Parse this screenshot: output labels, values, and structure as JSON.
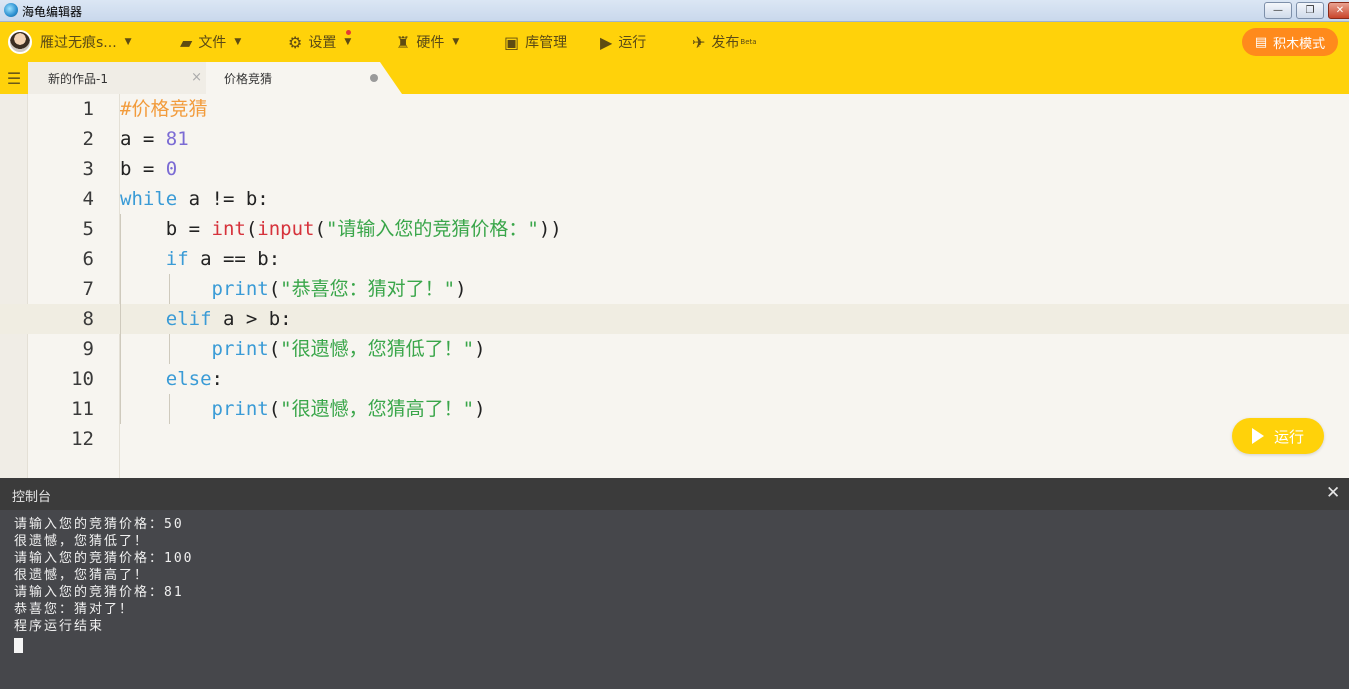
{
  "window": {
    "title": "海龟编辑器",
    "min_glyph": "—",
    "max_glyph": "❐",
    "close_glyph": "✕"
  },
  "toolbar": {
    "user_name": "雁过无痕s...",
    "file": "文件",
    "settings": "设置",
    "hardware": "硬件",
    "library": "库管理",
    "run": "运行",
    "publish": "发布",
    "publish_badge": "Beta",
    "block_mode": "积木模式"
  },
  "tabs": [
    {
      "label": "新的作品-1",
      "close_glyph": "×"
    },
    {
      "label": "价格竞猜"
    }
  ],
  "editor": {
    "line_numbers": [
      "1",
      "2",
      "3",
      "4",
      "5",
      "6",
      "7",
      "8",
      "9",
      "10",
      "11",
      "12"
    ],
    "active_line": 8,
    "lines": [
      "#价格竞猜",
      "a = 81",
      "b = 0",
      "while a != b:",
      "    b = int(input(\"请输入您的竞猜价格：\"))",
      "    if a == b:",
      "        print(\"恭喜您：猜对了！\")",
      "    elif a > b:",
      "        print(\"很遗憾，您猜低了！\")",
      "    else:",
      "        print(\"很遗憾，您猜高了！\")",
      ""
    ],
    "run_button": "运行"
  },
  "console": {
    "title": "控制台",
    "close_glyph": "✕",
    "output": [
      "请输入您的竞猜价格：50",
      "很遗憾，您猜低了！",
      "请输入您的竞猜价格：100",
      "很遗憾，您猜高了！",
      "请输入您的竞猜价格：81",
      "恭喜您：猜对了！",
      "程序运行结束"
    ]
  },
  "colors": {
    "accent": "#ffd20a",
    "block_mode": "#ff8a1c",
    "console_bg": "#46474b",
    "keyword": "#3a9bd6",
    "string": "#3aa64a",
    "builtin": "#d6323b",
    "number": "#7b6bd4",
    "comment": "#f29b3b"
  }
}
